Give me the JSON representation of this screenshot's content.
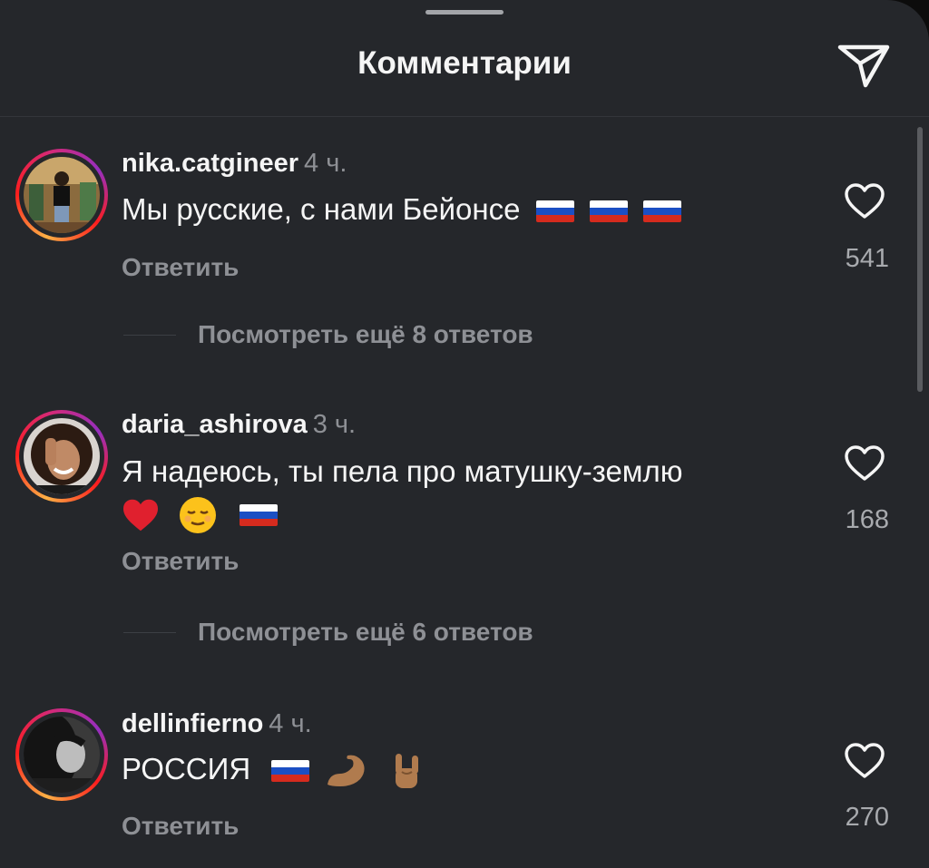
{
  "header": {
    "title": "Комментарии",
    "share_icon": "paper-plane-icon"
  },
  "colors": {
    "background": "#25272b",
    "text_primary": "#f5f5f5",
    "text_secondary": "#8e9095",
    "story_ring": [
      "#fcb045",
      "#fd1d1d",
      "#d62976",
      "#962fbf"
    ]
  },
  "comments": [
    {
      "username": "nika.catgineer",
      "time": "4 ч.",
      "text": "Мы русские, с нами Бейонсе",
      "emojis": [
        "flag-russia",
        "flag-russia",
        "flag-russia"
      ],
      "reply_label": "Ответить",
      "likes": "541",
      "more_replies": "Посмотреть ещё 8 ответов"
    },
    {
      "username": "daria_ashirova",
      "time": "3 ч.",
      "text": "Я надеюсь, ты пела про матушку-землю",
      "emojis": [
        "red-heart",
        "relieved-face",
        "flag-russia"
      ],
      "reply_label": "Ответить",
      "likes": "168",
      "more_replies": "Посмотреть ещё 6 ответов"
    },
    {
      "username": "dellinfierno",
      "time": "4 ч.",
      "text": "РОССИЯ",
      "emojis": [
        "flag-russia",
        "flexed-biceps",
        "sign-of-horns"
      ],
      "reply_label": "Ответить",
      "likes": "270"
    }
  ]
}
